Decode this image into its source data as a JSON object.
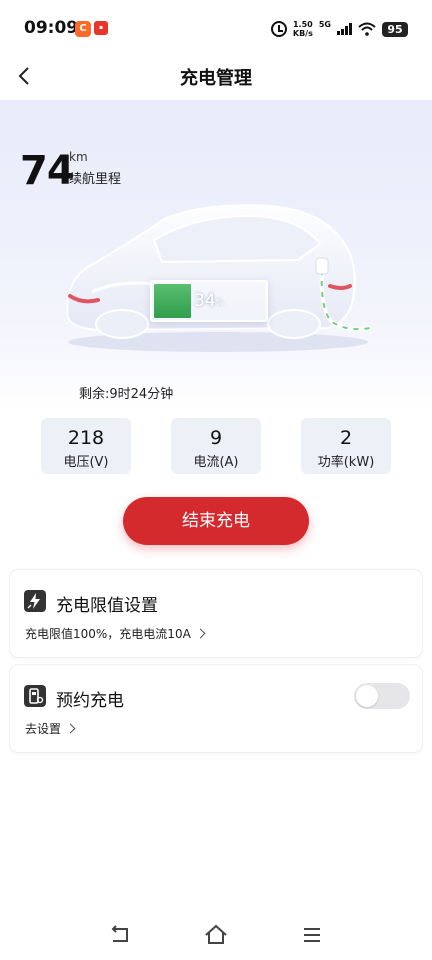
{
  "status_bar": {
    "time": "09:09",
    "net_speed_value": "1.50",
    "net_speed_unit": "KB/s",
    "network": "5G",
    "battery": "95",
    "icons": [
      "alarm-icon",
      "signal-icon",
      "wifi-icon",
      "battery-icon"
    ]
  },
  "header": {
    "title": "充电管理",
    "back_icon": "chevron-left-icon"
  },
  "vehicle": {
    "range_value": "74",
    "range_unit": "km",
    "range_label": "续航里程",
    "battery_percent_text": "34",
    "battery_percent_sign": "%",
    "battery_level": 0.34,
    "battery_fill_color": "#3faa57",
    "remaining_time": "剩余:9时24分钟"
  },
  "stats": [
    {
      "value": "218",
      "label": "电压(V)"
    },
    {
      "value": "9",
      "label": "电流(A)"
    },
    {
      "value": "2",
      "label": "功率(kW)"
    }
  ],
  "actions": {
    "stop_charging": "结束充电",
    "accent_color": "#d42a2e"
  },
  "cards": {
    "limit": {
      "icon": "lightning-icon",
      "title": "充电限值设置",
      "subtitle": "充电限值100%，充电电流10A"
    },
    "reserve": {
      "icon": "charging-pile-icon",
      "title": "预约充电",
      "subtitle": "去设置",
      "toggle_on": false
    }
  },
  "nav": {
    "icons": [
      "back-icon",
      "home-icon",
      "menu-icon"
    ]
  }
}
